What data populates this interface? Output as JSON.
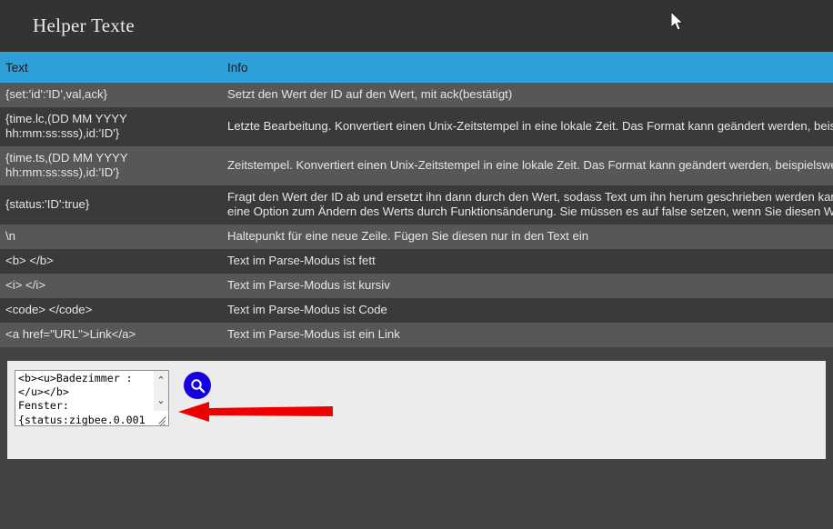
{
  "window": {
    "title": "Helper Texte",
    "accent_blue": "#2f9fd8",
    "header_bg": "#333333",
    "page_bg": "#434343",
    "row_light": "#575757",
    "row_dark": "#3a3a3a",
    "panel_bg": "#ececec",
    "button_blue": "#1400e0",
    "arrow_red": "#ee0000"
  },
  "table": {
    "columns": [
      "Text",
      "Info"
    ],
    "rows": [
      {
        "text": "{set:'id':'ID',val,ack}",
        "info": "Setzt den Wert der ID auf den Wert, mit ack(bestätigt)"
      },
      {
        "text": "{time.lc,(DD MM YYYY\nhh:mm:ss:sss),id:'ID'}",
        "info": "Letzte Bearbeitung. Konvertiert einen Unix-Zeitstempel in eine lokale Zeit. Das Format kann geändert werden, beispielsweise"
      },
      {
        "text": "{time.ts,(DD MM YYYY\nhh:mm:ss:sss),id:'ID'}",
        "info": "Zeitstempel. Konvertiert einen Unix-Zeitstempel in eine lokale Zeit. Das Format kann geändert werden, beispielsweise"
      },
      {
        "text": "{status:'ID':true}",
        "info": "Fragt den Wert der ID ab und ersetzt ihn dann durch den Wert, sodass Text um ihn herum geschrieben werden kann. Das true ist\neine Option zum Ändern des Werts durch Funktionsänderung. Sie müssen es auf false setzen, wenn Sie diesen Wert nicht"
      },
      {
        "text": "\\n",
        "info": "Haltepunkt für eine neue Zeile. Fügen Sie diesen nur in den Text ein"
      },
      {
        "text": "<b> </b>",
        "info": "Text im Parse-Modus ist fett"
      },
      {
        "text": "<i> </i>",
        "info": "Text im Parse-Modus ist kursiv"
      },
      {
        "text": "<code> </code>",
        "info": "Text im Parse-Modus ist Code"
      },
      {
        "text": "<a href=\"URL\">Link</a>",
        "info": "Text im Parse-Modus ist ein Link"
      }
    ]
  },
  "editor": {
    "textarea_value": "<b><u>Badezimmer :\n</u></b>\nFenster:\n{status:zigbee.0.001",
    "scroll_up_glyph": "⌃",
    "scroll_down_glyph": "⌄",
    "search_button_label": "search-icon"
  }
}
